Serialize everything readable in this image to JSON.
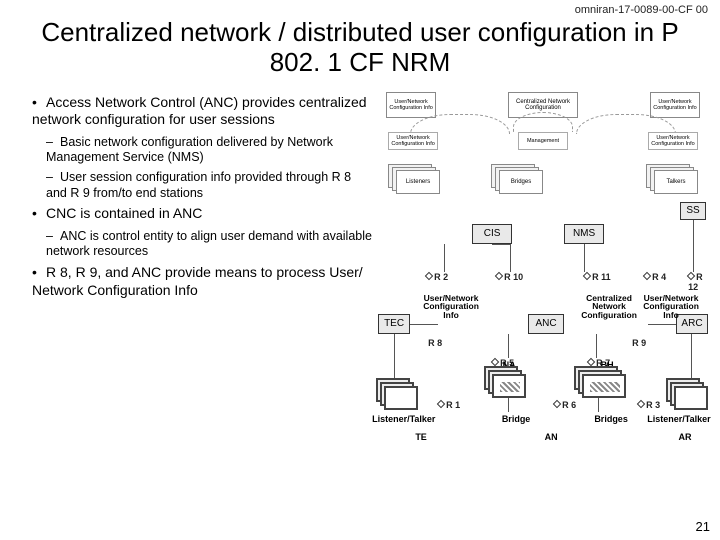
{
  "doc_id": "omniran-17-0089-00-CF 00",
  "title": "Centralized network / distributed user configuration in P 802. 1 CF NRM",
  "page_number": "21",
  "bullets": {
    "b1a": "Access Network Control (ANC) provides centralized network configuration for user sessions",
    "b2a": "Basic network configuration delivered by Network Management Service (NMS)",
    "b2b": "User session configuration info provided through R 8 and R 9 from/to end stations",
    "b1b": "CNC is contained in ANC",
    "b2c": "ANC is control entity to align user demand with available network resources",
    "b1c": "R 8, R 9, and ANC provide means to process User/ Network Configuration Info"
  },
  "upper": {
    "cnc": "Centralized Network Configuration",
    "left_box": "User/Network Configuration Info",
    "right_box": "User/Network Configuration Info",
    "attr1": "User/Network Configuration Info",
    "attr2": "Management",
    "attr3": "User/Network Configuration Info",
    "stack1": "Listeners",
    "stack2": "Bridges",
    "stack3": "Talkers"
  },
  "nodes": {
    "cis": "CIS",
    "nms": "NMS",
    "ss": "SS",
    "tec": "TEC",
    "anc": "ANC",
    "arc": "ARC"
  },
  "refs": {
    "r1": "R 1",
    "r2": "R 2",
    "r3": "R 3",
    "r4": "R 4",
    "r5": "R 5",
    "r6": "R 6",
    "r7": "R 7",
    "r8": "R 8",
    "r9": "R 9",
    "r10": "R 10",
    "r11": "R 11",
    "r12": "R 12"
  },
  "cfg": {
    "left": "User/Network Configuration Info",
    "center": "Centralized Network Configuration",
    "right": "User/Network Configuration Info"
  },
  "caps": {
    "lt1": "Listener/Talker",
    "na": "NA",
    "bh": "BH",
    "bridge": "Bridge",
    "bridges": "Bridges",
    "lt2": "Listener/Talker",
    "te": "TE",
    "an": "AN",
    "ar": "AR"
  }
}
